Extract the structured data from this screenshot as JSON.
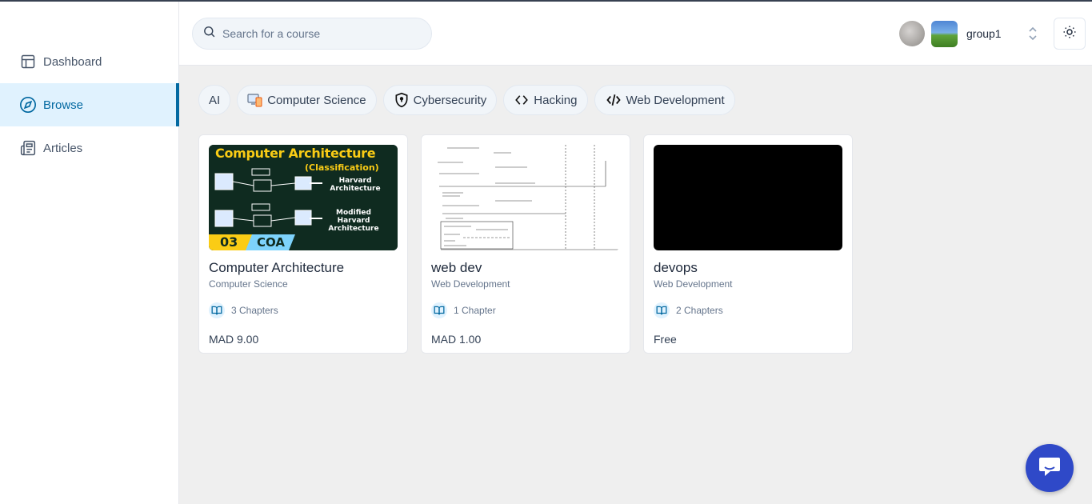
{
  "sidebar": {
    "items": [
      {
        "label": "Dashboard",
        "icon": "layout-icon"
      },
      {
        "label": "Browse",
        "icon": "compass-icon",
        "active": true
      },
      {
        "label": "Articles",
        "icon": "newspaper-icon"
      }
    ]
  },
  "header": {
    "search": {
      "placeholder": "Search for a course"
    },
    "org_name": "group1"
  },
  "categories": [
    {
      "label": "AI"
    },
    {
      "label": "Computer Science",
      "icon": "computer-icon"
    },
    {
      "label": "Cybersecurity",
      "icon": "shield-icon"
    },
    {
      "label": "Hacking",
      "icon": "code-brackets-icon"
    },
    {
      "label": "Web Development",
      "icon": "code-slash-icon"
    }
  ],
  "courses": [
    {
      "title": "Computer Architecture",
      "category": "Computer Science",
      "chapters": "3 Chapters",
      "price": "MAD 9.00",
      "thumb": {
        "heading": "Computer Architecture",
        "subheading": "(Classification)",
        "label1_line1": "Harvard",
        "label1_line2": "Architecture",
        "label2_line1": "Modified",
        "label2_line2": "Harvard",
        "label2_line3": "Architecture",
        "badge_num": "03",
        "badge_text": "COA"
      }
    },
    {
      "title": "web dev",
      "category": "Web Development",
      "chapters": "1 Chapter",
      "price": "MAD 1.00"
    },
    {
      "title": "devops",
      "category": "Web Development",
      "chapters": "2 Chapters",
      "price": "Free"
    }
  ],
  "colors": {
    "accent": "#0369a1",
    "chat_button": "#2f49c8",
    "active_bg": "#e0f2fe"
  }
}
